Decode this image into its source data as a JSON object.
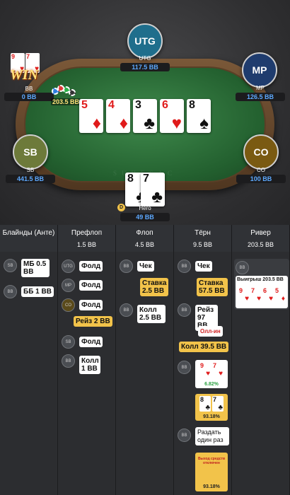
{
  "table": {
    "felt_text": "SUHESAC",
    "pot": "203.5 BB",
    "win_badge": "WIN",
    "board": [
      {
        "rank": "5",
        "suit": "♦",
        "color": "red"
      },
      {
        "rank": "4",
        "suit": "♦",
        "color": "red"
      },
      {
        "rank": "3",
        "suit": "♣",
        "color": "blk"
      },
      {
        "rank": "6",
        "suit": "♥",
        "color": "red"
      },
      {
        "rank": "8",
        "suit": "♠",
        "color": "blk"
      }
    ],
    "players": {
      "utg": {
        "avatar": "UTG",
        "name": "UTG",
        "stack": "117.5 BB"
      },
      "mp": {
        "avatar": "MP",
        "name": "MP",
        "stack": "126.5 BB"
      },
      "bb": {
        "name": "BB",
        "stack": "0 BB",
        "cards": [
          {
            "rank": "9",
            "suit": "♥"
          },
          {
            "rank": "7",
            "suit": "♥"
          }
        ]
      },
      "sb": {
        "avatar": "SB",
        "name": "SB",
        "stack": "441.5 BB"
      },
      "co": {
        "avatar": "CO",
        "name": "CO",
        "stack": "100 BB"
      },
      "hero": {
        "name": "Hero",
        "stack": "49 BB",
        "dealer": "D",
        "cards": [
          {
            "rank": "8",
            "suit": "♣"
          },
          {
            "rank": "7",
            "suit": "♣"
          }
        ]
      }
    },
    "colors": {
      "utg": "#1f6e8c",
      "mp": "#1f3c6e",
      "sb": "#6d7a3a",
      "co": "#7a5a12"
    }
  },
  "headers": [
    {
      "title": "Блайнды (Анте)",
      "value": ""
    },
    {
      "title": "Префлоп",
      "value": "1.5 BB"
    },
    {
      "title": "Флоп",
      "value": "4.5 BB"
    },
    {
      "title": "Тёрн",
      "value": "9.5 BB"
    },
    {
      "title": "Ривер",
      "value": "203.5 BB"
    }
  ],
  "actions": {
    "blinds": [
      {
        "pos": "SB",
        "text": "МБ 0.5 BB"
      },
      {
        "pos": "BB",
        "text": "ББ 1 BB"
      }
    ],
    "preflop": [
      {
        "pos": "UTG",
        "text": "Фолд"
      },
      {
        "pos": "MP",
        "text": "Фолд"
      },
      {
        "pos": "CO",
        "text": "Фолд"
      },
      {
        "pos": "",
        "text": "Рейз 2 BB"
      },
      {
        "pos": "SB",
        "text": "Фолд"
      },
      {
        "pos": "BB",
        "text": "Колл 1 BB"
      }
    ],
    "flop": [
      {
        "pos": "BB",
        "text": "Чек"
      },
      {
        "pos": "",
        "text": "Ставка 2.5 BB"
      },
      {
        "pos": "BB",
        "text": "Колл 2.5 BB"
      }
    ],
    "turn": [
      {
        "pos": "BB",
        "text": "Чек"
      },
      {
        "pos": "",
        "text": "Ставка 57.5 BB"
      },
      {
        "pos": "BB",
        "text": "Рейз 97 BB"
      },
      {
        "pos": "",
        "text": "Олл-ин"
      },
      {
        "pos": "",
        "text": "Колл 39.5 BB"
      },
      {
        "pos": "BB",
        "text": "6.82%"
      },
      {
        "pos": "",
        "text": "93.18%"
      },
      {
        "pos": "BB",
        "text": "Раздать один раз"
      },
      {
        "pos": "",
        "text": "Выход средств отключен"
      },
      {
        "pos": "",
        "text": "93.18%"
      }
    ],
    "river": {
      "pos": "BB",
      "text": "Выигрыш 203.5 BB",
      "cards": [
        {
          "rank": "9",
          "suit": "♥"
        },
        {
          "rank": "7",
          "suit": "♥"
        },
        {
          "rank": "6",
          "suit": "♥"
        },
        {
          "rank": "5",
          "suit": "♦"
        }
      ]
    }
  }
}
